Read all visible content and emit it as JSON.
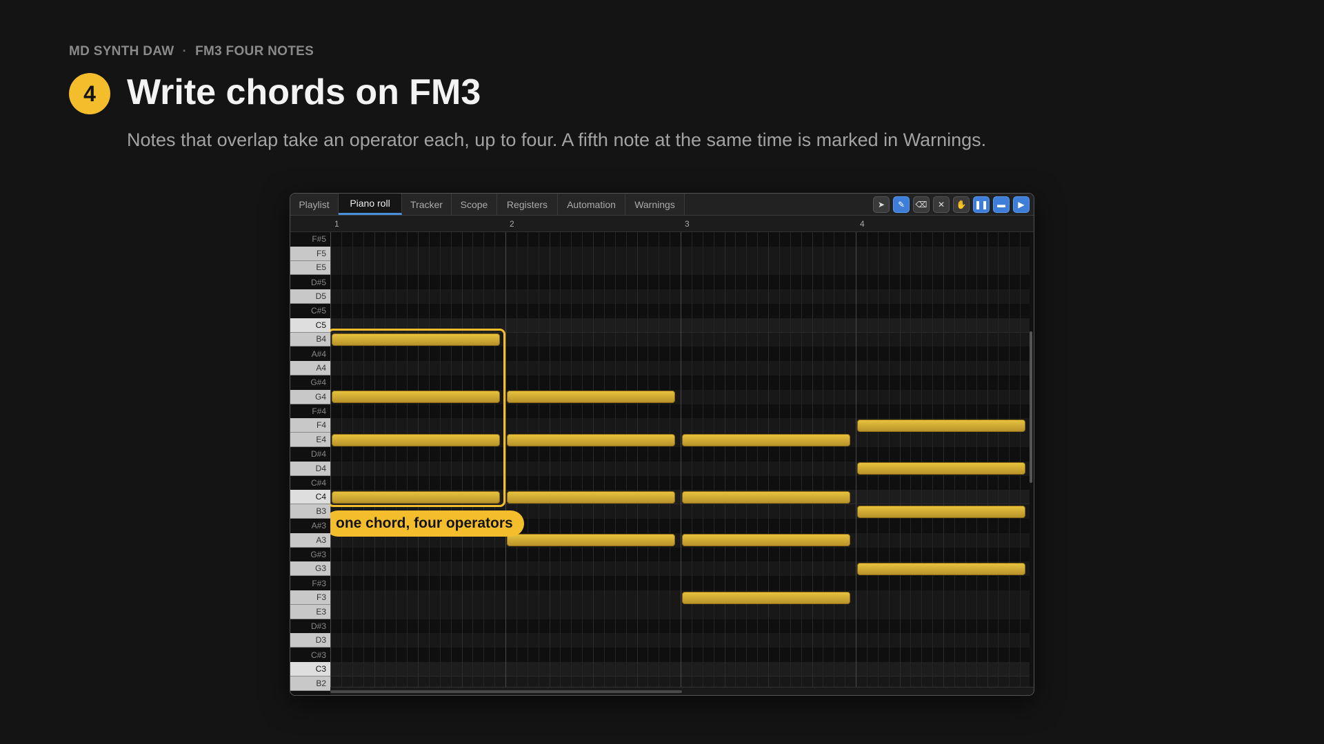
{
  "header": {
    "app_name": "MD SYNTH DAW",
    "separator": "·",
    "section": "FM3 FOUR NOTES",
    "step": "4",
    "title": "Write chords on FM3",
    "subtitle": "Notes that overlap take an operator each, up to four. A fifth note at the same time is marked in Warnings."
  },
  "tabs": [
    {
      "label": "Playlist",
      "active": false
    },
    {
      "label": "Piano roll",
      "active": true
    },
    {
      "label": "Tracker",
      "active": false
    },
    {
      "label": "Scope",
      "active": false
    },
    {
      "label": "Registers",
      "active": false
    },
    {
      "label": "Automation",
      "active": false
    },
    {
      "label": "Warnings",
      "active": false
    }
  ],
  "toolbar": [
    {
      "icon": "pointer-icon",
      "glyph": "➤",
      "on": false
    },
    {
      "icon": "pencil-icon",
      "glyph": "✎",
      "on": true
    },
    {
      "icon": "eraser-icon",
      "glyph": "⌫",
      "on": false
    },
    {
      "icon": "cut-icon",
      "glyph": "✕",
      "on": false
    },
    {
      "icon": "hand-icon",
      "glyph": "✋",
      "on": false
    },
    {
      "icon": "pause-icon",
      "glyph": "❚❚",
      "on": true
    },
    {
      "icon": "loop-icon",
      "glyph": "▬",
      "on": true
    },
    {
      "icon": "play-icon",
      "glyph": "▶",
      "on": true
    }
  ],
  "bars": [
    "1",
    "2",
    "3",
    "4"
  ],
  "keys": [
    "F#5",
    "F5",
    "E5",
    "D#5",
    "D5",
    "C#5",
    "C5",
    "B4",
    "A#4",
    "A4",
    "G#4",
    "G4",
    "F#4",
    "F4",
    "E4",
    "D#4",
    "D4",
    "C#4",
    "C4",
    "B3",
    "A#3",
    "A3",
    "G#3",
    "G3",
    "F#3",
    "F3",
    "E3",
    "D#3",
    "D3",
    "C#3",
    "C3",
    "B2"
  ],
  "notes": [
    {
      "pitch": "B4",
      "bar": 1,
      "length_bars": 1
    },
    {
      "pitch": "G4",
      "bar": 1,
      "length_bars": 1
    },
    {
      "pitch": "E4",
      "bar": 1,
      "length_bars": 1
    },
    {
      "pitch": "C4",
      "bar": 1,
      "length_bars": 1
    },
    {
      "pitch": "G4",
      "bar": 2,
      "length_bars": 1
    },
    {
      "pitch": "E4",
      "bar": 2,
      "length_bars": 1
    },
    {
      "pitch": "C4",
      "bar": 2,
      "length_bars": 1
    },
    {
      "pitch": "A3",
      "bar": 2,
      "length_bars": 1
    },
    {
      "pitch": "E4",
      "bar": 3,
      "length_bars": 1
    },
    {
      "pitch": "C4",
      "bar": 3,
      "length_bars": 1
    },
    {
      "pitch": "A3",
      "bar": 3,
      "length_bars": 1
    },
    {
      "pitch": "F3",
      "bar": 3,
      "length_bars": 1
    },
    {
      "pitch": "F4",
      "bar": 4,
      "length_bars": 1
    },
    {
      "pitch": "D4",
      "bar": 4,
      "length_bars": 1
    },
    {
      "pitch": "B3",
      "bar": 4,
      "length_bars": 1
    },
    {
      "pitch": "G3",
      "bar": 4,
      "length_bars": 1
    }
  ],
  "highlight": {
    "bar": 1,
    "top_pitch": "B4",
    "bottom_pitch": "C4"
  },
  "callout": "one chord, four operators",
  "colors": {
    "accent": "#f4bd2c",
    "note": "#e0bb3a",
    "tab_active": "#4a8fdc"
  }
}
